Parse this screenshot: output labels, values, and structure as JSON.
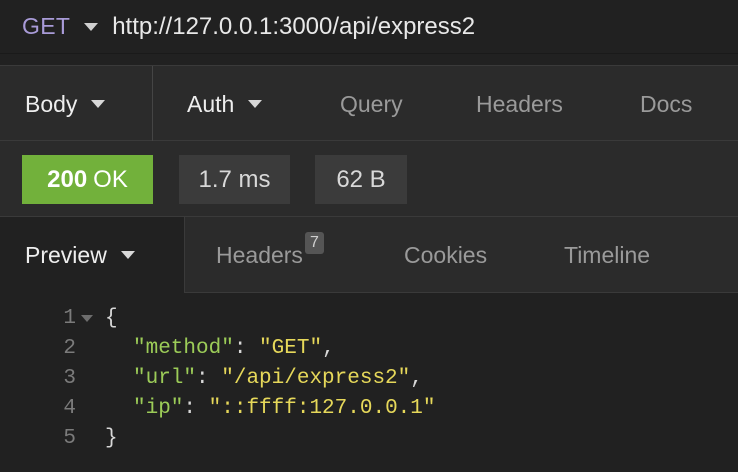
{
  "request": {
    "method": "GET",
    "url": "http://127.0.0.1:3000/api/express2"
  },
  "request_tabs": [
    {
      "label": "Body",
      "has_dropdown": true,
      "active": true
    },
    {
      "label": "Auth",
      "has_dropdown": true,
      "active": true
    },
    {
      "label": "Query",
      "has_dropdown": false,
      "active": false
    },
    {
      "label": "Headers",
      "has_dropdown": false,
      "active": false
    },
    {
      "label": "Docs",
      "has_dropdown": false,
      "active": false
    }
  ],
  "status": {
    "code": "200",
    "text": "OK",
    "time": "1.7 ms",
    "size": "62 B",
    "colors": {
      "ok": "#72b13b"
    }
  },
  "response_tabs": [
    {
      "label": "Preview",
      "has_dropdown": true,
      "active": true
    },
    {
      "label": "Headers",
      "count": "7",
      "active": false
    },
    {
      "label": "Cookies",
      "active": false
    },
    {
      "label": "Timeline",
      "active": false
    }
  ],
  "response_body": {
    "line_numbers": [
      "1",
      "2",
      "3",
      "4",
      "5"
    ],
    "open_brace": "{",
    "close_brace": "}",
    "fields": [
      {
        "key": "\"method\"",
        "value": "\"GET\"",
        "trailing": ","
      },
      {
        "key": "\"url\"",
        "value": "\"/api/express2\"",
        "trailing": ","
      },
      {
        "key": "\"ip\"",
        "value": "\"::ffff:127.0.0.1\"",
        "trailing": ""
      }
    ],
    "colors": {
      "key": "#9ccc58",
      "string": "#e6d85a"
    }
  },
  "icons": {
    "method_dropdown": "chevron-down-icon",
    "tab_dropdown": "chevron-down-icon",
    "fold": "fold-arrow-icon"
  }
}
